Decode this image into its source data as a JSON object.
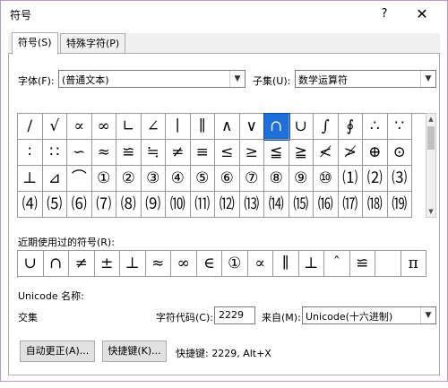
{
  "window": {
    "title": "符号",
    "help": "?",
    "close": "✕"
  },
  "tabs": [
    {
      "label": "符号(S)"
    },
    {
      "label": "特殊字符(P)"
    }
  ],
  "font": {
    "label": "字体(F):",
    "value": "(普通文本)"
  },
  "subset": {
    "label": "子集(U):",
    "value": "数学运算符"
  },
  "symbols": [
    [
      "/",
      "√",
      "∝",
      "∞",
      "∟",
      "∠",
      "∣",
      "∥",
      "∧",
      "∨",
      "∩",
      "∪",
      "∫",
      "∮",
      "∴",
      "∵"
    ],
    [
      "∶",
      "∷",
      "∽",
      "≈",
      "≌",
      "≒",
      "≠",
      "≡",
      "≤",
      "≥",
      "≦",
      "≧",
      "≮",
      "≯",
      "⊕",
      "⊙"
    ],
    [
      "⊥",
      "⊿",
      "⌒",
      "①",
      "②",
      "③",
      "④",
      "⑤",
      "⑥",
      "⑦",
      "⑧",
      "⑨",
      "⑩",
      "⑴",
      "⑵",
      "⑶"
    ],
    [
      "⑷",
      "⑸",
      "⑹",
      "⑺",
      "⑻",
      "⑼",
      "⑽",
      "⑾",
      "⑿",
      "⒀",
      "⒁",
      "⒂",
      "⒃",
      "⒄",
      "⒅",
      "⒆"
    ]
  ],
  "selected_symbol": "∩",
  "recent": {
    "label": "近期使用过的符号(R):",
    "items": [
      "∪",
      "∩",
      "≠",
      "±",
      "⊥",
      "≈",
      "∞",
      "∈",
      "①",
      "∝",
      "∥",
      "⊥",
      "ˆ",
      "≌",
      "",
      "π"
    ]
  },
  "unicode_name_label": "Unicode 名称:",
  "unicode_name_value": "交集",
  "char_code": {
    "label": "字符代码(C):",
    "value": "2229"
  },
  "from": {
    "label": "来自(M):",
    "value": "Unicode(十六进制)"
  },
  "buttons": {
    "autocorrect": "自动更正(A)...",
    "shortcut": "快捷键(K)..."
  },
  "shortcut_text": "快捷键: 2229, Alt+X"
}
